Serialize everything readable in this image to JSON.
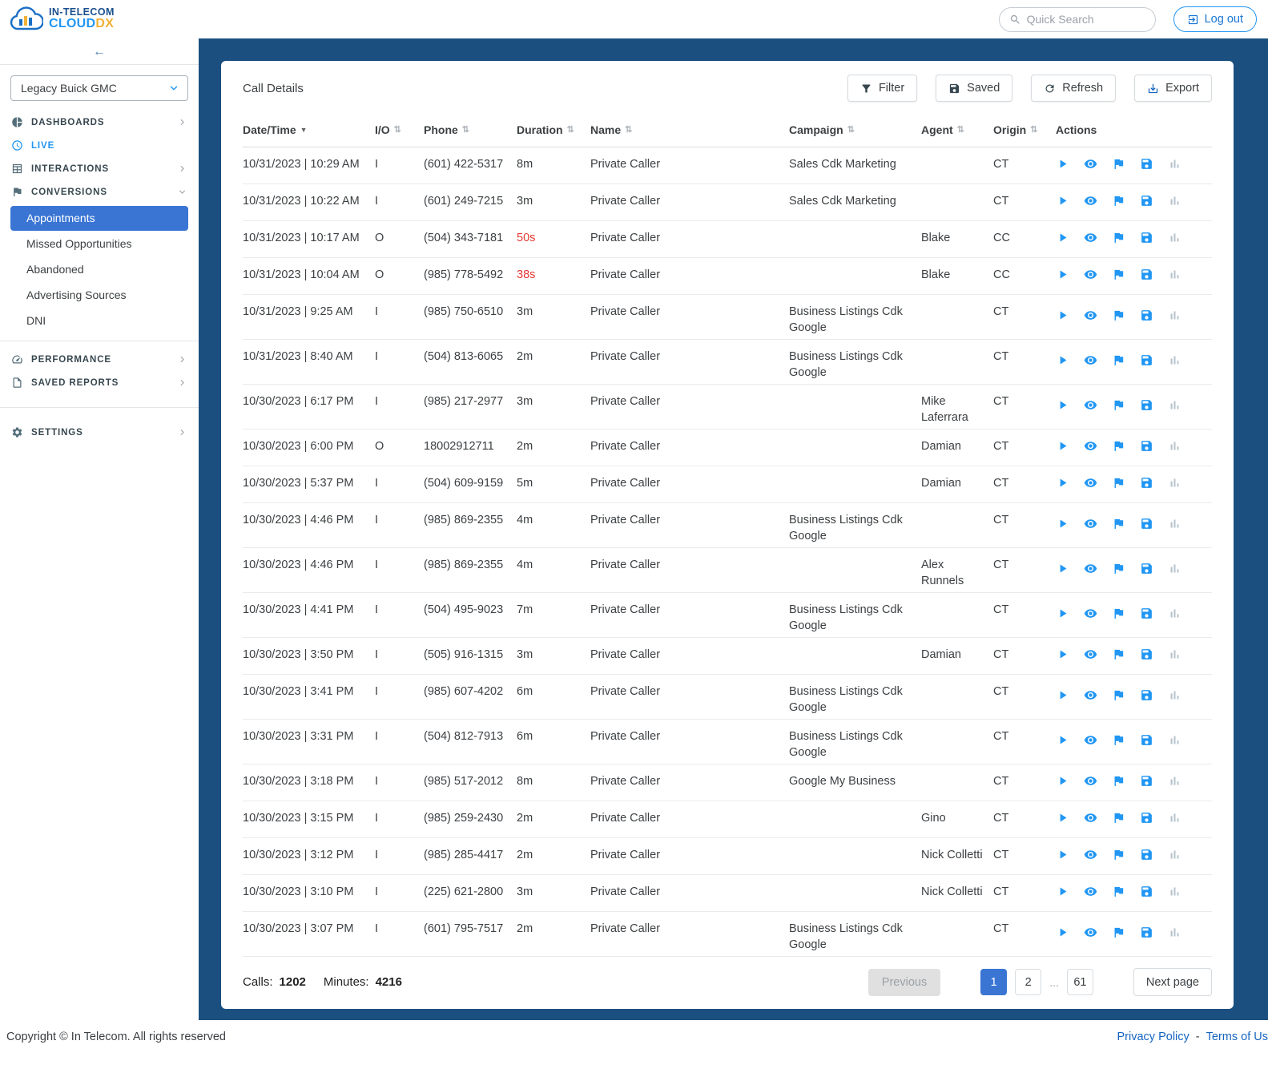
{
  "header": {
    "logo_line1": "IN-TELECOM",
    "logo_cloud": "CLOUD",
    "logo_dx": "DX",
    "search_placeholder": "Quick Search",
    "logout_label": "Log out"
  },
  "sidebar": {
    "collapse_glyph": "←",
    "account_selector": "Legacy Buick GMC",
    "items": [
      {
        "label": "DASHBOARDS",
        "icon": "pie-chart-icon",
        "chevron": "right"
      },
      {
        "label": "LIVE",
        "icon": "clock-icon",
        "chevron": null
      },
      {
        "label": "INTERACTIONS",
        "icon": "table-icon",
        "chevron": "right"
      },
      {
        "label": "CONVERSIONS",
        "icon": "flag-icon",
        "chevron": "down"
      },
      {
        "label": "PERFORMANCE",
        "icon": "speed-icon",
        "chevron": "right"
      },
      {
        "label": "SAVED REPORTS",
        "icon": "document-icon",
        "chevron": "right"
      },
      {
        "label": "SETTINGS",
        "icon": "gear-icon",
        "chevron": "right"
      }
    ],
    "conversions": {
      "items": [
        {
          "label": "Appointments",
          "active": true
        },
        {
          "label": "Missed Opportunities",
          "active": false
        },
        {
          "label": "Abandoned",
          "active": false
        },
        {
          "label": "Advertising Sources",
          "active": false
        },
        {
          "label": "DNI",
          "active": false
        }
      ]
    }
  },
  "main": {
    "title": "Call Details",
    "toolbar": {
      "filter_label": "Filter",
      "saved_label": "Saved",
      "refresh_label": "Refresh",
      "export_label": "Export"
    },
    "table": {
      "sort_glyph": "⇅",
      "sort_desc_glyph": "▼",
      "columns": [
        {
          "label": "Date/Time",
          "sortable": true,
          "sorted": "desc"
        },
        {
          "label": "I/O",
          "sortable": true
        },
        {
          "label": "Phone",
          "sortable": true
        },
        {
          "label": "Duration",
          "sortable": true
        },
        {
          "label": "Name",
          "sortable": true
        },
        {
          "label": "Campaign",
          "sortable": true
        },
        {
          "label": "Agent",
          "sortable": true
        },
        {
          "label": "Origin",
          "sortable": true
        },
        {
          "label": "Actions",
          "sortable": false
        }
      ],
      "action_icons": [
        "play-icon",
        "eye-icon",
        "flag-icon",
        "save-icon",
        "chart-icon"
      ],
      "rows": [
        {
          "datetime": "10/31/2023 | 10:29 AM",
          "io": "I",
          "phone": "(601) 422-5317",
          "duration": "8m",
          "duration_alert": false,
          "name": "Private Caller",
          "campaign": "Sales Cdk Marketing",
          "agent": "",
          "origin": "CT"
        },
        {
          "datetime": "10/31/2023 | 10:22 AM",
          "io": "I",
          "phone": "(601) 249-7215",
          "duration": "3m",
          "duration_alert": false,
          "name": "Private Caller",
          "campaign": "Sales Cdk Marketing",
          "agent": "",
          "origin": "CT"
        },
        {
          "datetime": "10/31/2023 | 10:17 AM",
          "io": "O",
          "phone": "(504) 343-7181",
          "duration": "50s",
          "duration_alert": true,
          "name": "Private Caller",
          "campaign": "",
          "agent": "Blake",
          "origin": "CC"
        },
        {
          "datetime": "10/31/2023 | 10:04 AM",
          "io": "O",
          "phone": "(985) 778-5492",
          "duration": "38s",
          "duration_alert": true,
          "name": "Private Caller",
          "campaign": "",
          "agent": "Blake",
          "origin": "CC"
        },
        {
          "datetime": "10/31/2023 | 9:25 AM",
          "io": "I",
          "phone": "(985) 750-6510",
          "duration": "3m",
          "duration_alert": false,
          "name": "Private Caller",
          "campaign": "Business Listings Cdk Google",
          "agent": "",
          "origin": "CT"
        },
        {
          "datetime": "10/31/2023 | 8:40 AM",
          "io": "I",
          "phone": "(504) 813-6065",
          "duration": "2m",
          "duration_alert": false,
          "name": "Private Caller",
          "campaign": "Business Listings Cdk Google",
          "agent": "",
          "origin": "CT"
        },
        {
          "datetime": "10/30/2023 | 6:17 PM",
          "io": "I",
          "phone": "(985) 217-2977",
          "duration": "3m",
          "duration_alert": false,
          "name": "Private Caller",
          "campaign": "",
          "agent": "Mike Laferrara",
          "origin": "CT"
        },
        {
          "datetime": "10/30/2023 | 6:00 PM",
          "io": "O",
          "phone": "18002912711",
          "duration": "2m",
          "duration_alert": false,
          "name": "Private Caller",
          "campaign": "",
          "agent": "Damian",
          "origin": "CT"
        },
        {
          "datetime": "10/30/2023 | 5:37 PM",
          "io": "I",
          "phone": "(504) 609-9159",
          "duration": "5m",
          "duration_alert": false,
          "name": "Private Caller",
          "campaign": "",
          "agent": "Damian",
          "origin": "CT"
        },
        {
          "datetime": "10/30/2023 | 4:46 PM",
          "io": "I",
          "phone": "(985) 869-2355",
          "duration": "4m",
          "duration_alert": false,
          "name": "Private Caller",
          "campaign": "Business Listings Cdk Google",
          "agent": "",
          "origin": "CT"
        },
        {
          "datetime": "10/30/2023 | 4:46 PM",
          "io": "I",
          "phone": "(985) 869-2355",
          "duration": "4m",
          "duration_alert": false,
          "name": "Private Caller",
          "campaign": "",
          "agent": "Alex Runnels",
          "origin": "CT"
        },
        {
          "datetime": "10/30/2023 | 4:41 PM",
          "io": "I",
          "phone": "(504) 495-9023",
          "duration": "7m",
          "duration_alert": false,
          "name": "Private Caller",
          "campaign": "Business Listings Cdk Google",
          "agent": "",
          "origin": "CT"
        },
        {
          "datetime": "10/30/2023 | 3:50 PM",
          "io": "I",
          "phone": "(505) 916-1315",
          "duration": "3m",
          "duration_alert": false,
          "name": "Private Caller",
          "campaign": "",
          "agent": "Damian",
          "origin": "CT"
        },
        {
          "datetime": "10/30/2023 | 3:41 PM",
          "io": "I",
          "phone": "(985) 607-4202",
          "duration": "6m",
          "duration_alert": false,
          "name": "Private Caller",
          "campaign": "Business Listings Cdk Google",
          "agent": "",
          "origin": "CT"
        },
        {
          "datetime": "10/30/2023 | 3:31 PM",
          "io": "I",
          "phone": "(504) 812-7913",
          "duration": "6m",
          "duration_alert": false,
          "name": "Private Caller",
          "campaign": "Business Listings Cdk Google",
          "agent": "",
          "origin": "CT"
        },
        {
          "datetime": "10/30/2023 | 3:18 PM",
          "io": "I",
          "phone": "(985) 517-2012",
          "duration": "8m",
          "duration_alert": false,
          "name": "Private Caller",
          "campaign": "Google My Business",
          "agent": "",
          "origin": "CT"
        },
        {
          "datetime": "10/30/2023 | 3:15 PM",
          "io": "I",
          "phone": "(985) 259-2430",
          "duration": "2m",
          "duration_alert": false,
          "name": "Private Caller",
          "campaign": "",
          "agent": "Gino",
          "origin": "CT"
        },
        {
          "datetime": "10/30/2023 | 3:12 PM",
          "io": "I",
          "phone": "(985) 285-4417",
          "duration": "2m",
          "duration_alert": false,
          "name": "Private Caller",
          "campaign": "",
          "agent": "Nick Colletti",
          "origin": "CT"
        },
        {
          "datetime": "10/30/2023 | 3:10 PM",
          "io": "I",
          "phone": "(225) 621-2800",
          "duration": "3m",
          "duration_alert": false,
          "name": "Private Caller",
          "campaign": "",
          "agent": "Nick Colletti",
          "origin": "CT"
        },
        {
          "datetime": "10/30/2023 | 3:07 PM",
          "io": "I",
          "phone": "(601) 795-7517",
          "duration": "2m",
          "duration_alert": false,
          "name": "Private Caller",
          "campaign": "Business Listings Cdk Google",
          "agent": "",
          "origin": "CT"
        }
      ]
    },
    "summary": {
      "calls_label": "Calls:",
      "calls_value": "1202",
      "minutes_label": "Minutes:",
      "minutes_value": "4216"
    },
    "pagination": {
      "previous_label": "Previous",
      "page1": "1",
      "page2": "2",
      "ellipsis": "...",
      "last_page": "61",
      "next_label": "Next page",
      "current_page": "1"
    }
  },
  "footer": {
    "copyright": "Copyright © In Telecom. All rights reserved",
    "privacy_label": "Privacy Policy",
    "separator": "-",
    "terms_label": "Terms of Us"
  },
  "colors": {
    "main_background": "#1b4f80",
    "accent_blue": "#3a75d4",
    "icon_blue": "#2196f3",
    "alert_red": "#e53935",
    "logo_yellow": "#f2b136"
  }
}
